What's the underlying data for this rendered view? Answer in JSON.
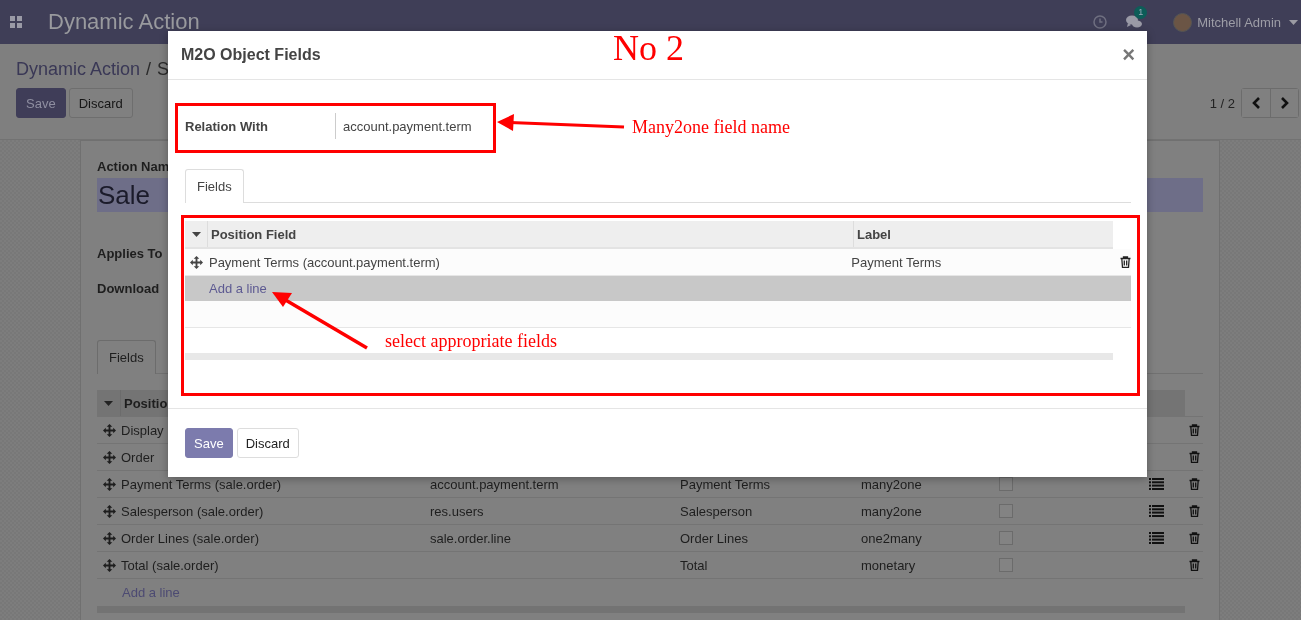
{
  "navbar": {
    "app_title": "Dynamic Action",
    "notification_count": "1",
    "user": "Mitchell Admin"
  },
  "control_panel": {
    "breadcrumb": "Dynamic Action",
    "separator": "/",
    "current": "S",
    "buttons": [
      {
        "label": "Save",
        "kind": "primary"
      },
      {
        "label": "Discard",
        "kind": "secondary"
      }
    ],
    "pager": "1 / 2"
  },
  "form": {
    "name_label": "Action Nam",
    "name_value": "Sale",
    "labels": [
      "Applies To",
      "Download"
    ],
    "tabs": [
      {
        "label": "Fields",
        "selected": true
      }
    ],
    "columns": [
      "Positio"
    ],
    "rows": [
      {
        "position_field": "Display",
        "has_list": false
      },
      {
        "position_field": "Order",
        "has_list": false
      },
      {
        "position_field": "Payment Terms (sale.order)",
        "relation": "account.payment.term",
        "label": "Payment Terms",
        "type": "many2one",
        "checked": false,
        "has_list": true
      },
      {
        "position_field": "Salesperson (sale.order)",
        "relation": "res.users",
        "label": "Salesperson",
        "type": "many2one",
        "checked": false,
        "has_list": true
      },
      {
        "position_field": "Order Lines (sale.order)",
        "relation": "sale.order.line",
        "label": "Order Lines",
        "type": "one2many",
        "checked": false,
        "has_list": true
      },
      {
        "position_field": "Total (sale.order)",
        "label": "Total",
        "type": "monetary",
        "checked": false,
        "has_list": false
      }
    ],
    "add_line": "Add a line"
  },
  "dialog": {
    "title": "M2O Object Fields",
    "close": "×",
    "relation_label": "Relation With",
    "relation_value": "account.payment.term",
    "tabs": [
      {
        "label": "Fields",
        "selected": true
      }
    ],
    "columns": [
      "Position Field",
      "Label"
    ],
    "rows": [
      {
        "position_field": "Payment Terms (account.payment.term)",
        "label": "Payment Terms"
      }
    ],
    "add_line": "Add a line",
    "buttons": [
      {
        "label": "Save",
        "kind": "primary"
      },
      {
        "label": "Discard",
        "kind": "secondary"
      }
    ]
  },
  "annotations": {
    "title": "No 2",
    "notes": [
      "Many2one field name",
      "select appropriate fields"
    ]
  }
}
